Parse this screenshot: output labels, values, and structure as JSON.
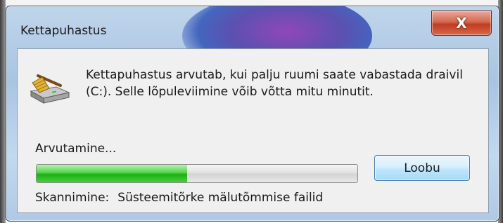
{
  "window": {
    "title": "Kettapuhastus",
    "close_label": "X"
  },
  "message": "Kettapuhastus arvutab, kui palju ruumi saate vabastada draivil  (C:). Selle lõpuleviimine võib võtta mitu minutit.",
  "icon": "disk-cleanup-drive-icon",
  "progress": {
    "label": "Arvutamine...",
    "fraction": 0.47
  },
  "cancel_label": "Loobu",
  "scan": {
    "label": "Skannimine:",
    "value": "Süsteemitõrke mälutõmmise failid"
  },
  "colors": {
    "progress_fill": "#1fae15",
    "close_button": "#c03c1f",
    "button_border": "#3c7fb1"
  }
}
